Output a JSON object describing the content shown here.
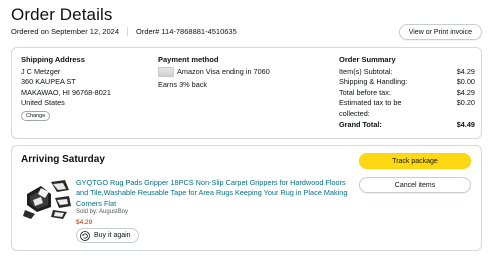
{
  "header": {
    "title": "Order Details",
    "ordered_on": "Ordered on September 12, 2024",
    "order_number": "Order# 114-7868881-4510635",
    "print_label": "View or Print invoice"
  },
  "shipping": {
    "title": "Shipping Address",
    "lines": [
      "J C Metzger",
      "360 KAUPEA ST",
      "MAKAWAO, HI 96768-8021",
      "United States"
    ],
    "change_label": "Change"
  },
  "payment": {
    "title": "Payment method",
    "card_text": "Amazon Visa  ending in 7060",
    "earn_text": "Earns 3% back",
    "card_icon": "credit-card-icon"
  },
  "summary": {
    "title": "Order Summary",
    "rows": [
      {
        "label": "Item(s) Subtotal:",
        "value": "$4.29"
      },
      {
        "label": "Shipping & Handling:",
        "value": "$0.00"
      },
      {
        "label": "Total before tax:",
        "value": "$4.29"
      },
      {
        "label": "Estimated tax to be collected:",
        "value": "$0.20"
      }
    ],
    "grand_label": "Grand Total:",
    "grand_value": "$4.49"
  },
  "shipment": {
    "status": "Arriving Saturday",
    "track_label": "Track package",
    "cancel_label": "Cancel items",
    "item": {
      "title": "GYQTGO Rug Pads Gripper 18PCS Non-Slip Carpet Grippers for Hardwood Floors and Tile,Washable Reusable Tape for Area Rugs Keeping Your Rug in Place Making Corners Flat",
      "sold_by": "Sold by: AugustBoy",
      "price": "$4.29",
      "buy_again_label": "Buy it again"
    }
  },
  "colors": {
    "link": "#007185",
    "price": "#b12704",
    "track_button": "#ffd814",
    "border": "#d5d9d9"
  }
}
